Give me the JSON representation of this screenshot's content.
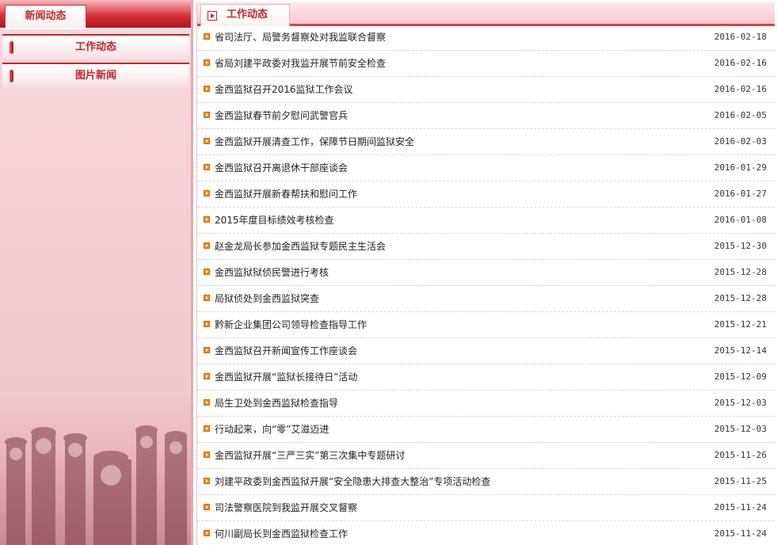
{
  "sidebar": {
    "header_tab": "新闻动态",
    "items": [
      {
        "label": "工作动态"
      },
      {
        "label": "图片新闻"
      }
    ]
  },
  "main": {
    "tab_label": "工作动态",
    "news": [
      {
        "title": "省司法厅、局警务督察处对我监联合督察",
        "date": "2016-02-18"
      },
      {
        "title": "省局刘建平政委对我监开展节前安全检查",
        "date": "2016-02-16"
      },
      {
        "title": "金西监狱召开2016监狱工作会议",
        "date": "2016-02-16"
      },
      {
        "title": "金西监狱春节前夕慰问武警官兵",
        "date": "2016-02-05"
      },
      {
        "title": "金西监狱开展清查工作，保障节日期间监狱安全",
        "date": "2016-02-03"
      },
      {
        "title": "金西监狱召开离退休干部座谈会",
        "date": "2016-01-29"
      },
      {
        "title": "金西监狱开展新春帮扶和慰问工作",
        "date": "2016-01-27"
      },
      {
        "title": "2015年度目标绩效考核检查",
        "date": "2016-01-08"
      },
      {
        "title": "赵金龙局长参加金西监狱专题民主生活会",
        "date": "2015-12-30"
      },
      {
        "title": "金西监狱狱侦民警进行考核",
        "date": "2015-12-28"
      },
      {
        "title": "局狱侦处到金西监狱突查",
        "date": "2015-12-28"
      },
      {
        "title": "黔新企业集团公司领导检查指导工作",
        "date": "2015-12-21"
      },
      {
        "title": "金西监狱召开新闻宣传工作座谈会",
        "date": "2015-12-14"
      },
      {
        "title": "金西监狱开展“监狱长接待日”活动",
        "date": "2015-12-09"
      },
      {
        "title": "局生卫处到金西监狱检查指导",
        "date": "2015-12-03"
      },
      {
        "title": "行动起来，向“零”艾滋迈进",
        "date": "2015-12-03"
      },
      {
        "title": "金西监狱开展“三严三实”第三次集中专题研讨",
        "date": "2015-11-26"
      },
      {
        "title": "刘建平政委到金西监狱开展“安全隐患大排查大整治”专项活动检查",
        "date": "2015-11-25"
      },
      {
        "title": "司法警察医院到我监开展交叉督察",
        "date": "2015-11-24"
      },
      {
        "title": "何川副局长到金西监狱检查工作",
        "date": "2015-11-24"
      }
    ]
  },
  "colors": {
    "accent": "#c1272d",
    "bullet": "#f08a1a",
    "sidebar_bg": "#f3cfd4"
  }
}
